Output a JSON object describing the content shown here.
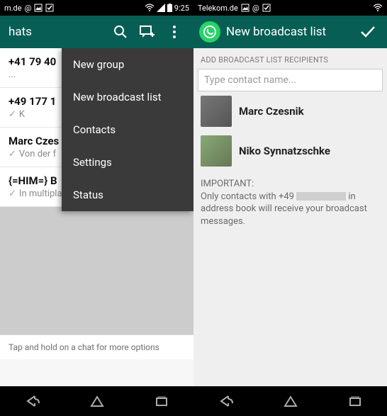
{
  "left": {
    "statusbar": {
      "carrier": "m.de",
      "at": "@",
      "time": "9:25"
    },
    "actionbar": {
      "title": "hats"
    },
    "menu": {
      "items": [
        {
          "label": "New group"
        },
        {
          "label": "New broadcast list"
        },
        {
          "label": "Contacts"
        },
        {
          "label": "Settings"
        },
        {
          "label": "Status"
        }
      ]
    },
    "chats": [
      {
        "name": "+41 79 40",
        "sub": "..."
      },
      {
        "name": "+49 177 1",
        "sub": "K",
        "check": true
      },
      {
        "name": "Marc Czes",
        "sub": "Von der f",
        "check": true
      },
      {
        "name": "{=HIM=} B",
        "sub": "In multiplayer!",
        "check": true
      }
    ],
    "hint": "Tap and hold on a chat for more options"
  },
  "right": {
    "statusbar": {
      "carrier": "Telekom.de"
    },
    "actionbar": {
      "title": "New broadcast list"
    },
    "section_label": "ADD BROADCAST LIST RECIPIENTS",
    "input_placeholder": "Type contact name...",
    "contacts": [
      {
        "name": "Marc Czesnik"
      },
      {
        "name": "Niko Synnatzschke"
      }
    ],
    "note_important": "IMPORTANT:",
    "note_body_pre": "Only contacts with +49 ",
    "note_body_post": " in address book will receive your broadcast messages."
  }
}
